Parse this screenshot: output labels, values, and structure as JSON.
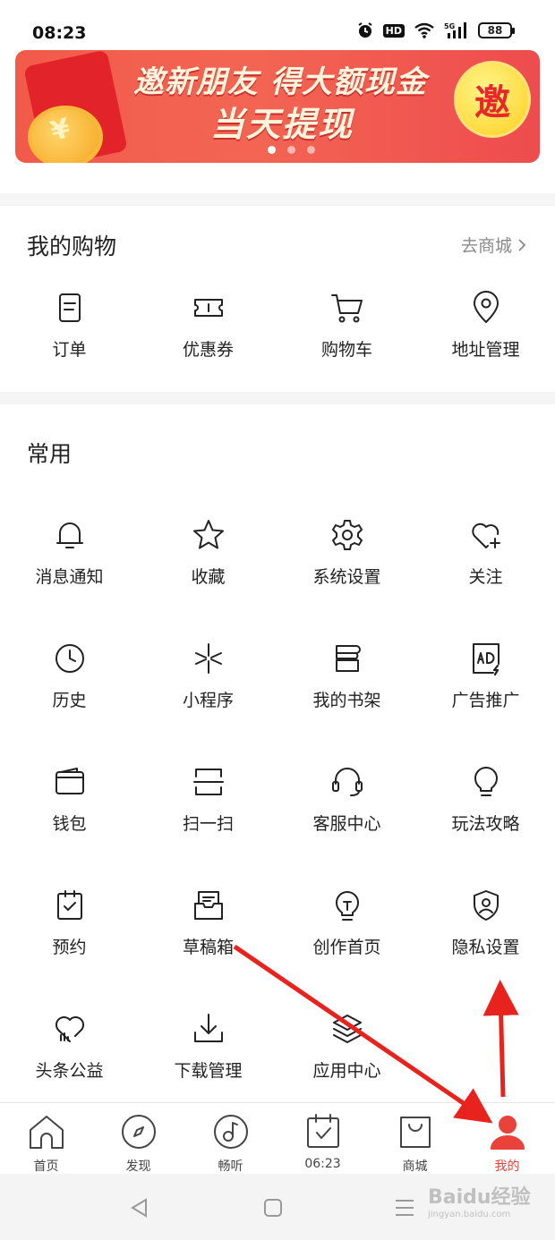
{
  "status_bar": {
    "time": "08:23",
    "hd": "HD",
    "battery": "88"
  },
  "banner": {
    "line1": "邀新朋友 得大额现金",
    "line2": "当天提现",
    "invite_label": "邀",
    "coin_sign": "¥"
  },
  "shopping": {
    "title": "我的购物",
    "goto_shop": "去商城",
    "items": [
      {
        "label": "订单",
        "icon": "order-icon"
      },
      {
        "label": "优惠券",
        "icon": "coupon-icon"
      },
      {
        "label": "购物车",
        "icon": "cart-icon"
      },
      {
        "label": "地址管理",
        "icon": "location-icon"
      }
    ]
  },
  "common": {
    "title": "常用",
    "items": [
      {
        "label": "消息通知",
        "icon": "bell-icon"
      },
      {
        "label": "收藏",
        "icon": "star-icon"
      },
      {
        "label": "系统设置",
        "icon": "gear-icon"
      },
      {
        "label": "关注",
        "icon": "heart-plus-icon"
      },
      {
        "label": "历史",
        "icon": "clock-icon"
      },
      {
        "label": "小程序",
        "icon": "mini-program-icon"
      },
      {
        "label": "我的书架",
        "icon": "bookshelf-icon"
      },
      {
        "label": "广告推广",
        "icon": "ad-icon"
      },
      {
        "label": "钱包",
        "icon": "wallet-icon"
      },
      {
        "label": "扫一扫",
        "icon": "scan-icon"
      },
      {
        "label": "客服中心",
        "icon": "headset-icon"
      },
      {
        "label": "玩法攻略",
        "icon": "bulb-icon"
      },
      {
        "label": "预约",
        "icon": "reserve-icon"
      },
      {
        "label": "草稿箱",
        "icon": "draft-icon"
      },
      {
        "label": "创作首页",
        "icon": "create-icon"
      },
      {
        "label": "隐私设置",
        "icon": "privacy-shield-icon"
      },
      {
        "label": "头条公益",
        "icon": "charity-icon"
      },
      {
        "label": "下载管理",
        "icon": "download-icon"
      },
      {
        "label": "应用中心",
        "icon": "layers-icon"
      }
    ]
  },
  "tabbar": {
    "tabs": [
      {
        "label": "首页",
        "icon": "home-icon"
      },
      {
        "label": "发现",
        "icon": "compass-icon"
      },
      {
        "label": "畅听",
        "icon": "music-icon"
      },
      {
        "label": "06:23",
        "icon": "calendar-check-icon"
      },
      {
        "label": "商城",
        "icon": "shopping-bag-icon"
      },
      {
        "label": "我的",
        "icon": "user-icon"
      }
    ],
    "active_color": "#e8423b"
  },
  "watermark": {
    "text": "Baidu经验",
    "sub": "jingyan.baidu.com"
  },
  "annotation": {
    "arrow_color": "#e8221c"
  }
}
